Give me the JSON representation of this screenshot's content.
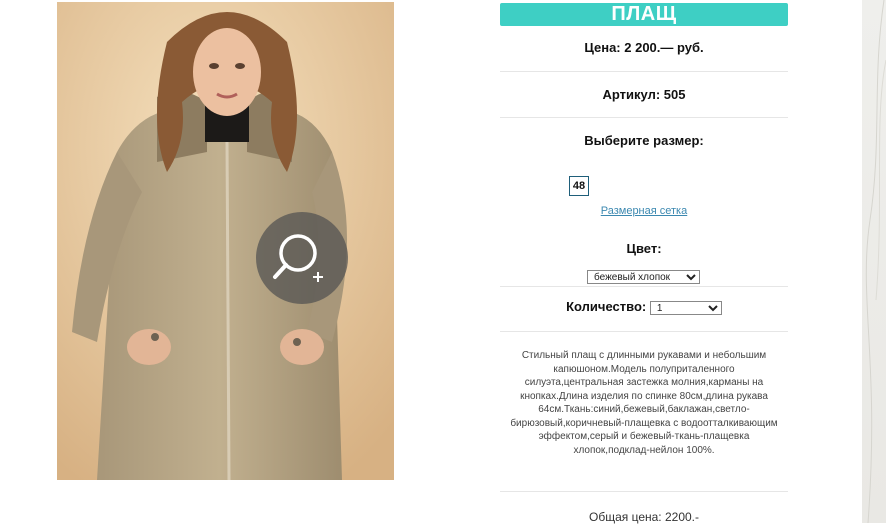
{
  "product": {
    "title": "ПЛАЩ",
    "price": "Цена: 2 200.— руб.",
    "article": "Артикул: 505",
    "choose_size_label": "Выберите размер:",
    "sizes": [
      "48"
    ],
    "size_chart_link": "Размерная сетка",
    "color_label": "Цвет:",
    "color_selected": "бежевый хлопок",
    "quantity_label": "Количество:",
    "quantity_selected": "1",
    "description": "Стильный плащ с длинными рукавами и небольшим капюшоном.Модель полуприталенного силуэта,центральная застежка молния,карманы на кнопках.Длина изделия по спинке 80см,длина рукава 64см.Ткань:синий,бежевый,баклажан,светло-бирюзовый,коричневый-плащевка с водоотталкивающим эффектом,серый и бежевый-ткань-плащевка хлопок,подклад-нейлон 100%.",
    "total": "Общая цена: 2200.-"
  },
  "image": {
    "zoom_icon": "zoom-in-icon"
  },
  "colors": {
    "accent": "#3ecfc4",
    "link": "#3b88b0"
  }
}
